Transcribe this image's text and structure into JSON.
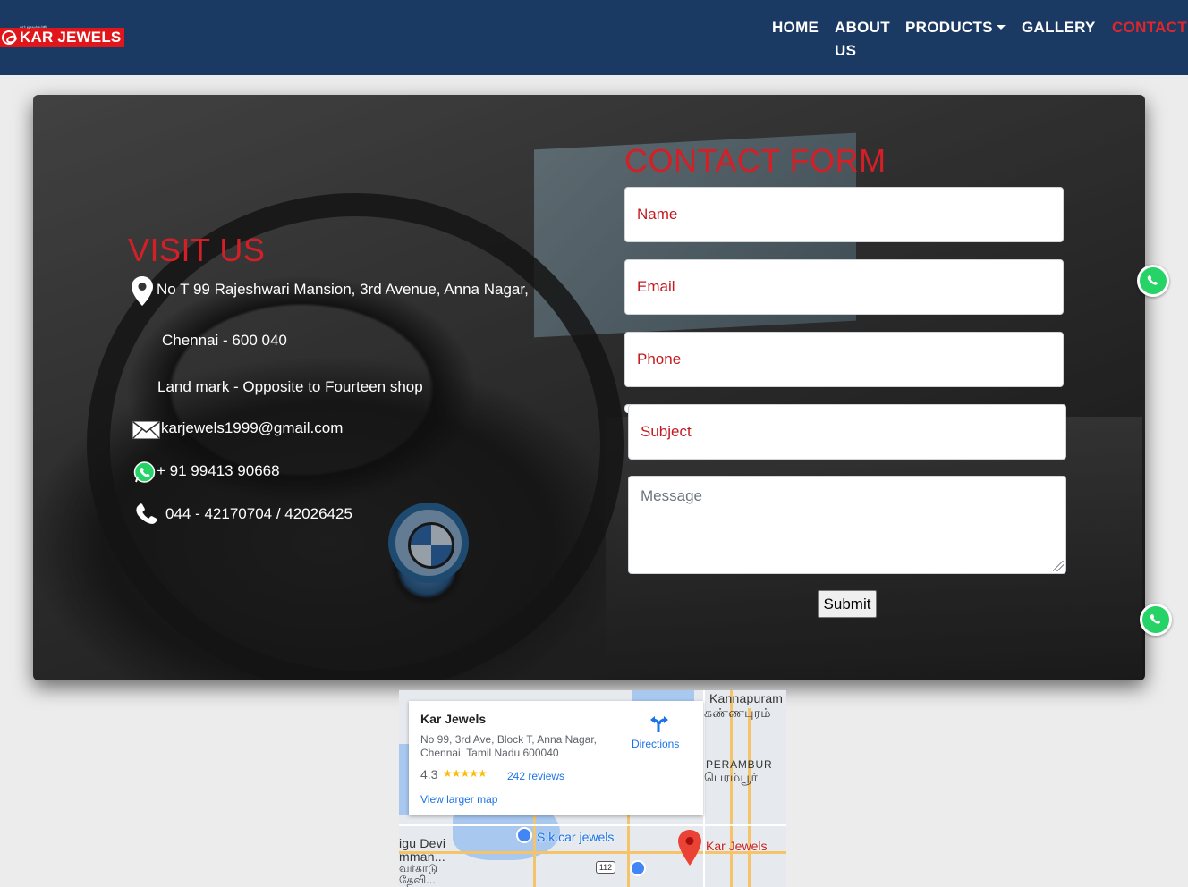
{
  "brand": {
    "name": "KAR JEWELS",
    "tagline": "கார் ஜுவல்லர்ஸ்"
  },
  "nav": {
    "items": [
      {
        "label": "HOME"
      },
      {
        "label": "ABOUT US"
      },
      {
        "label": "PRODUCTS"
      },
      {
        "label": "GALLERY"
      },
      {
        "label": "CONTACT"
      }
    ],
    "active": "CONTACT"
  },
  "visit": {
    "title": "VISIT US",
    "address_line1": "No T 99 Rajeshwari Mansion, 3rd Avenue, Anna Nagar,",
    "address_line2": "Chennai - 600 040",
    "landmark": "Land mark - Opposite to Fourteen shop",
    "email": "karjewels1999@gmail.com",
    "whatsapp": "+ 91 99413 90668",
    "phone": "044 - 42170704 / 42026425"
  },
  "form": {
    "title": "CONTACT FORM",
    "name_placeholder": "Name",
    "email_placeholder": "Email",
    "phone_placeholder": "Phone",
    "subject_placeholder": "Subject",
    "message_placeholder": "Message",
    "submit_label": "Submit"
  },
  "map": {
    "place_name": "Kar Jewels",
    "address": "No 99, 3rd Ave, Block T, Anna Nagar, Chennai, Tamil Nadu 600040",
    "rating": "4.3",
    "stars": "★★★★★",
    "reviews": "242 reviews",
    "directions": "Directions",
    "view_larger": "View larger map",
    "labels": {
      "kannapuram": "Kannapuram",
      "kannapuram_ta": "கண்ணபுரம்",
      "perambur": "PERAMBUR",
      "perambur_ta": "பெரம்பூர்",
      "igu_devi": "igu Devi",
      "mman": "mman...",
      "ta_vartadu": "வர்காடு",
      "ta_devi": "தேவி...",
      "sk_car": "S.k.car jewels",
      "pin_label": "Kar Jewels",
      "highway": "112"
    }
  },
  "colors": {
    "navbar": "#1b3a63",
    "accent_red": "#d51f26",
    "whatsapp": "#25d366"
  }
}
